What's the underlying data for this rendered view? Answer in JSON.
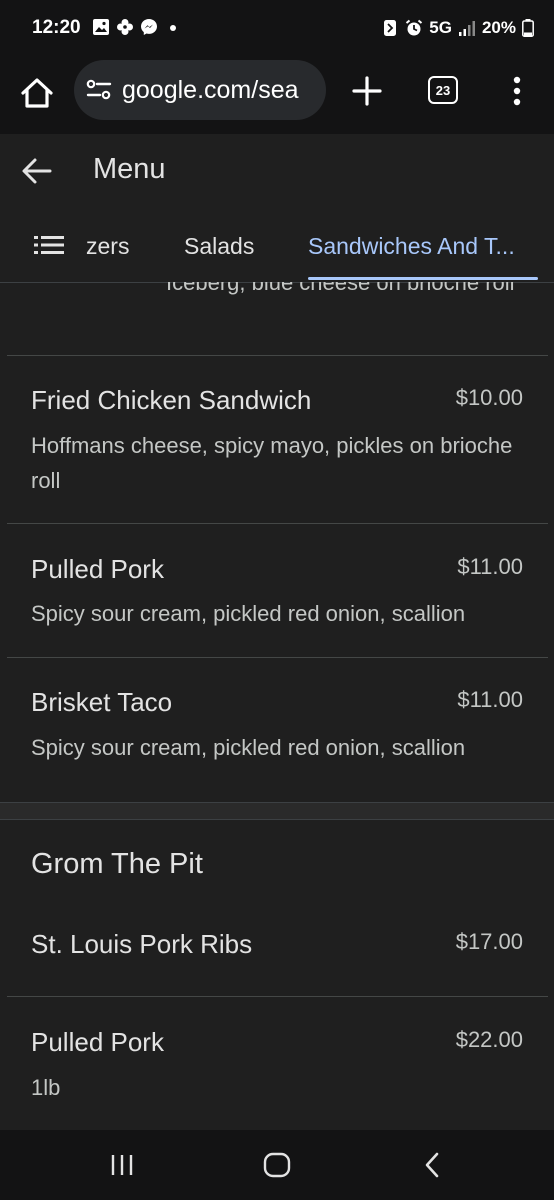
{
  "status_bar": {
    "time": "12:20",
    "network": "5G",
    "battery": "20%"
  },
  "browser": {
    "url": "google.com/sea",
    "tab_count": "23"
  },
  "header": {
    "title": "Menu"
  },
  "tabs": [
    {
      "label": "zers"
    },
    {
      "label": "Salads"
    },
    {
      "label": "Sandwiches And T..."
    }
  ],
  "content": {
    "partial_item_desc": "Iceberg, blue cheese on brioche roll",
    "items": [
      {
        "name": "Fried Chicken Sandwich",
        "price": "$10.00",
        "desc": "Hoffmans cheese, spicy mayo, pickles on brioche roll"
      },
      {
        "name": "Pulled Pork",
        "price": "$11.00",
        "desc": "Spicy sour cream, pickled red onion, scallion"
      },
      {
        "name": "Brisket Taco",
        "price": "$11.00",
        "desc": "Spicy sour cream, pickled red onion, scallion"
      }
    ],
    "section2": {
      "title": "Grom The Pit",
      "items": [
        {
          "name": "St. Louis Pork Ribs",
          "price": "$17.00"
        },
        {
          "name": "Pulled Pork",
          "price": "$22.00",
          "desc": "1lb"
        }
      ]
    }
  },
  "colors": {
    "background": "#1f1f1f",
    "accent_tab": "#a8c7fa",
    "toolbar": "#131314"
  }
}
